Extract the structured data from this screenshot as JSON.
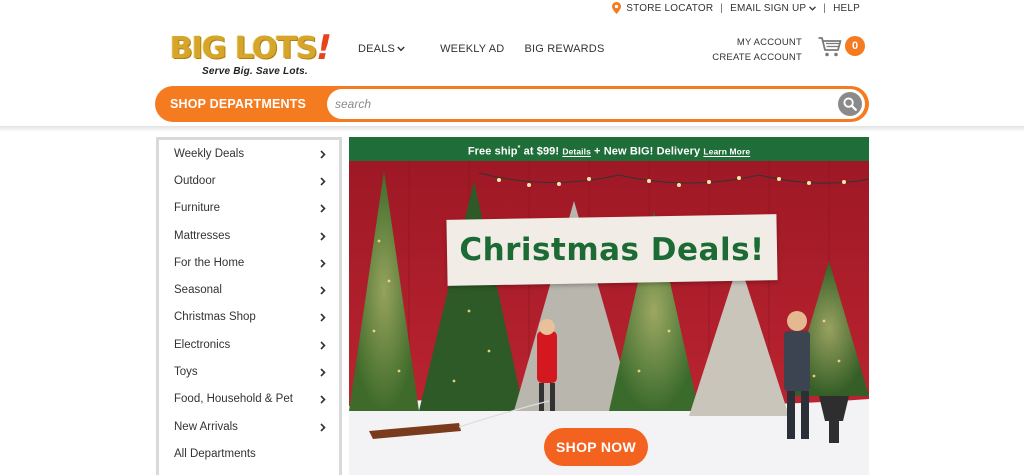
{
  "utility_bar": {
    "store_locator": "STORE LOCATOR",
    "email_signup": "EMAIL SIGN UP",
    "help": "HELP",
    "separator": "|"
  },
  "logo": {
    "wordmark": "BIG LOTS",
    "exclamation": "!",
    "tagline": "Serve Big. Save Lots."
  },
  "main_nav": {
    "deals": "DEALS",
    "weekly_ad": "WEEKLY AD",
    "big_rewards": "BIG REWARDS"
  },
  "account": {
    "my_account": "MY ACCOUNT",
    "create_account": "CREATE ACCOUNT"
  },
  "cart": {
    "count": "0",
    "icon": "cart-icon"
  },
  "search": {
    "shop_departments": "SHOP DEPARTMENTS",
    "placeholder": "search",
    "icon": "search-icon"
  },
  "sidebar": {
    "items": [
      {
        "label": "Weekly Deals"
      },
      {
        "label": "Outdoor"
      },
      {
        "label": "Furniture"
      },
      {
        "label": "Mattresses"
      },
      {
        "label": "For the Home"
      },
      {
        "label": "Seasonal"
      },
      {
        "label": "Christmas Shop"
      },
      {
        "label": "Electronics"
      },
      {
        "label": "Toys"
      },
      {
        "label": "Food, Household & Pet"
      },
      {
        "label": "New Arrivals"
      },
      {
        "label": "All Departments"
      }
    ]
  },
  "promo": {
    "free_ship": "Free ship",
    "asterisk": "*",
    "at_price": " at $99! ",
    "details": "Details",
    "plus_delivery": " + New BIG! Delivery ",
    "learn_more": "Learn More"
  },
  "hero": {
    "title": "Christmas Deals!",
    "cta": "SHOP NOW"
  },
  "colors": {
    "brand_orange": "#f47b20",
    "promo_green": "#1f6e3a",
    "hero_red": "#b51f2c"
  }
}
